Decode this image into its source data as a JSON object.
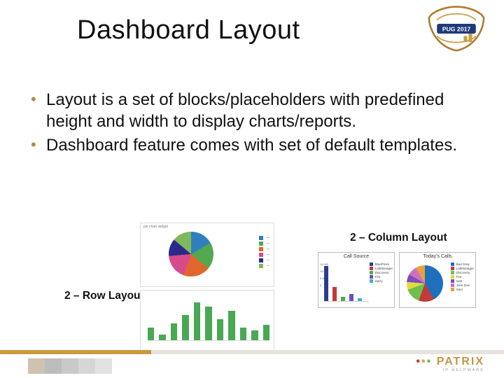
{
  "title": "Dashboard Layout",
  "badge": {
    "label": "PUG 2017"
  },
  "bullets": {
    "items": [
      "Layout is a set of blocks/placeholders with predefined height and width to display charts/reports.",
      " Dashboard feature comes with set of default templates."
    ]
  },
  "labels": {
    "column": "2 – Column Layout",
    "row": "2 – Row Layout"
  },
  "row_example": {
    "pie_header": "pie chart widget",
    "bars": [
      18,
      8,
      24,
      36,
      54,
      48,
      30,
      42,
      18,
      14,
      22
    ]
  },
  "col_example": {
    "left": {
      "title": "Call Source",
      "yticks": [
        "15,000",
        "10,000",
        "5,000",
        "0"
      ],
      "series": [
        {
          "name": "BluePrism",
          "color": "#2b3d8f",
          "h": 50
        },
        {
          "name": "LabManager",
          "color": "#c23a3a",
          "h": 20
        },
        {
          "name": "Discovery",
          "color": "#52a84f",
          "h": 6
        },
        {
          "name": "Fire",
          "color": "#6a4fbf",
          "h": 10
        },
        {
          "name": "Harry",
          "color": "#3cb0c9",
          "h": 4
        }
      ]
    },
    "right": {
      "title": "Today's Calls",
      "legend": [
        "Bud Gray",
        "LabManager",
        "Discovery",
        "Fire",
        "Ivan",
        "Jane Doe",
        "Sam"
      ]
    }
  },
  "brand": {
    "name": "PATRIX",
    "sub": "IP HELPWARE"
  }
}
